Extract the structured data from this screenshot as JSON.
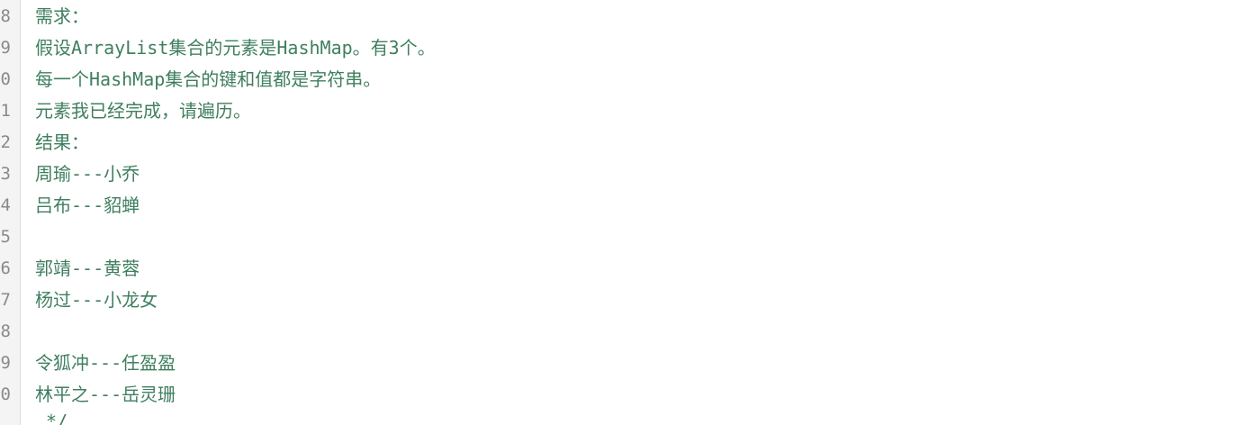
{
  "editor": {
    "lines": [
      {
        "number": "8",
        "text": "需求："
      },
      {
        "number": "9",
        "text": "假设ArrayList集合的元素是HashMap。有3个。"
      },
      {
        "number": "0",
        "text": "每一个HashMap集合的键和值都是字符串。"
      },
      {
        "number": "1",
        "text": "元素我已经完成，请遍历。"
      },
      {
        "number": "2",
        "text": "结果："
      },
      {
        "number": "3",
        "text": "周瑜---小乔"
      },
      {
        "number": "4",
        "text": "吕布---貂蝉"
      },
      {
        "number": "5",
        "text": ""
      },
      {
        "number": "6",
        "text": "郭靖---黄蓉"
      },
      {
        "number": "7",
        "text": "杨过---小龙女"
      },
      {
        "number": "8",
        "text": ""
      },
      {
        "number": "9",
        "text": "令狐冲---任盈盈"
      },
      {
        "number": "0",
        "text": "林平之---岳灵珊"
      },
      {
        "number": "",
        "text": " */"
      }
    ]
  },
  "colors": {
    "comment": "#3f7f5f",
    "line_number": "#8a8a8a",
    "gutter_bg": "#f4f4f4",
    "editor_bg": "#ffffff"
  }
}
